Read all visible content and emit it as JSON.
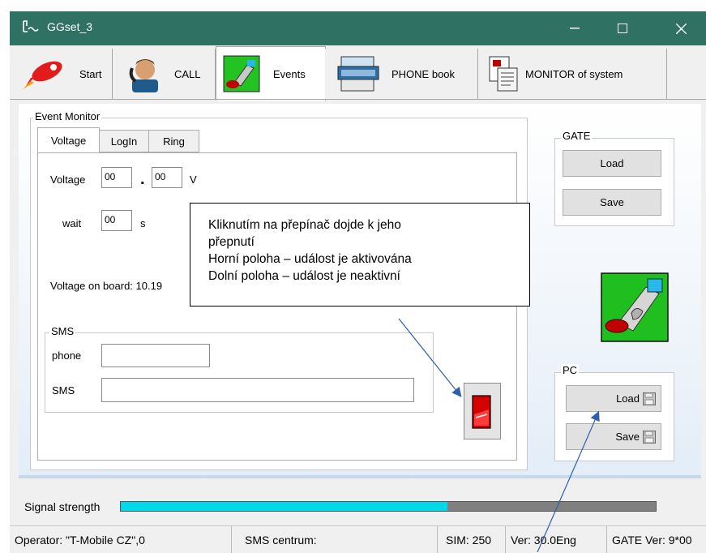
{
  "window": {
    "title": "GGset_3"
  },
  "tabs": [
    {
      "label": "Start"
    },
    {
      "label": "CALL"
    },
    {
      "label": "Events"
    },
    {
      "label": "PHONE book"
    },
    {
      "label": "MONITOR of system"
    }
  ],
  "event_monitor": {
    "label": "Event Monitor",
    "subtabs": [
      "Voltage",
      "LogIn",
      "Ring"
    ],
    "voltage": {
      "label": "Voltage",
      "whole": "00",
      "dot": ".",
      "decimal": "00",
      "unit": "V",
      "wait_label": "wait",
      "wait_value": "00",
      "wait_unit": "s",
      "on_board_label": "Voltage on board: 10.19"
    },
    "sms": {
      "group_label": "SMS",
      "phone_label": "phone",
      "phone_value": "",
      "sms_label": "SMS",
      "sms_value": ""
    }
  },
  "gate": {
    "label": "GATE",
    "load": "Load",
    "save": "Save"
  },
  "pc": {
    "label": "PC",
    "load": "Load",
    "save": "Save"
  },
  "callout": {
    "lines": [
      "Kliknutím na přepínač dojde k jeho",
      "přepnutí",
      "Horní poloha – událost je aktivována",
      "Dolní poloha – událost je neaktivní"
    ]
  },
  "signal": {
    "label": "Signal strength",
    "level": 0.61
  },
  "status": {
    "operator": "Operator: \"T-Mobile CZ\",0",
    "sms_centrum": "SMS centrum:",
    "sim": "SIM: 250",
    "ver": "Ver: 30.0Eng",
    "gate_ver": "GATE Ver: 9*00"
  },
  "colors": {
    "titlebar": "#2f7162",
    "signal_fill": "#00d8e8",
    "switch_red": "#d40000"
  }
}
